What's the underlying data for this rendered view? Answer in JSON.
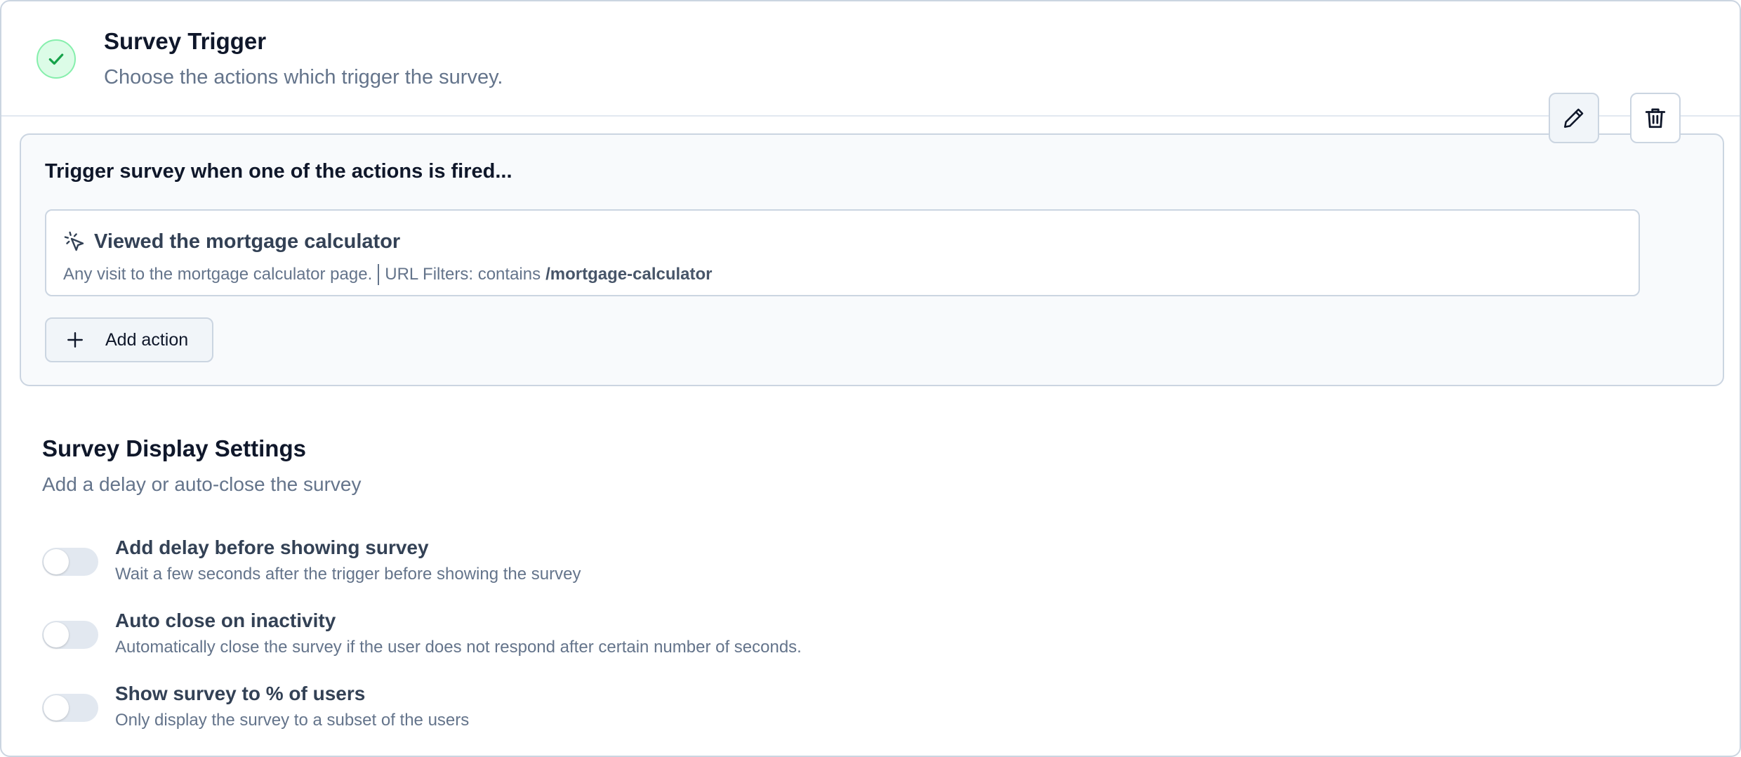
{
  "header": {
    "title": "Survey Trigger",
    "description": "Choose the actions which trigger the survey.",
    "status_icon": "check-icon"
  },
  "trigger_panel": {
    "title": "Trigger survey when one of the actions is fired...",
    "actions": [
      {
        "icon": "cursor-click-icon",
        "name": "Viewed the mortgage calculator",
        "description": "Any visit to the mortgage calculator page.",
        "filter_label": "URL Filters: contains",
        "filter_value": "/mortgage-calculator"
      }
    ],
    "add_action_label": "Add action"
  },
  "display_settings": {
    "title": "Survey Display Settings",
    "description": "Add a delay or auto-close the survey",
    "settings": [
      {
        "title": "Add delay before showing survey",
        "description": "Wait a few seconds after the trigger before showing the survey",
        "enabled": false
      },
      {
        "title": "Auto close on inactivity",
        "description": "Automatically close the survey if the user does not respond after certain number of seconds.",
        "enabled": false
      },
      {
        "title": "Show survey to % of users",
        "description": "Only display the survey to a subset of the users",
        "enabled": false
      }
    ]
  },
  "colors": {
    "success_bg": "#dcfce7",
    "success_check": "#16a34a",
    "border": "#cbd5e1",
    "muted_text": "#64748b",
    "heading_text": "#0f172a"
  }
}
